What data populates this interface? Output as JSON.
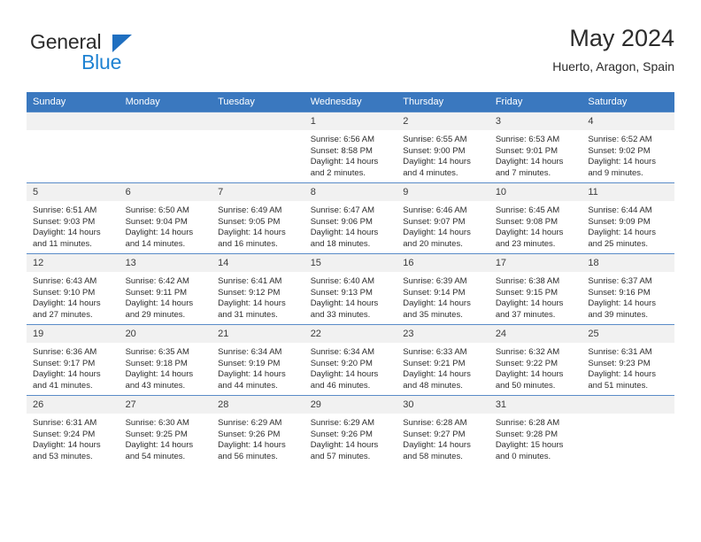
{
  "brand": {
    "name_part1": "General",
    "name_part2": "Blue",
    "triangle_color": "#1f6fc0",
    "blue_color": "#1f82d2"
  },
  "header": {
    "title": "May 2024",
    "subtitle": "Huerto, Aragon, Spain"
  },
  "theme": {
    "header_bg": "#3a78bf",
    "header_text": "#ffffff",
    "daynum_bg": "#f1f1f1",
    "row_divider": "#5a8cc8",
    "body_text": "#2d2d2d"
  },
  "weekdays": [
    "Sunday",
    "Monday",
    "Tuesday",
    "Wednesday",
    "Thursday",
    "Friday",
    "Saturday"
  ],
  "weeks": [
    [
      {
        "day": "",
        "empty": true
      },
      {
        "day": "",
        "empty": true
      },
      {
        "day": "",
        "empty": true
      },
      {
        "day": "1",
        "sunrise": "Sunrise: 6:56 AM",
        "sunset": "Sunset: 8:58 PM",
        "daylight1": "Daylight: 14 hours",
        "daylight2": "and 2 minutes."
      },
      {
        "day": "2",
        "sunrise": "Sunrise: 6:55 AM",
        "sunset": "Sunset: 9:00 PM",
        "daylight1": "Daylight: 14 hours",
        "daylight2": "and 4 minutes."
      },
      {
        "day": "3",
        "sunrise": "Sunrise: 6:53 AM",
        "sunset": "Sunset: 9:01 PM",
        "daylight1": "Daylight: 14 hours",
        "daylight2": "and 7 minutes."
      },
      {
        "day": "4",
        "sunrise": "Sunrise: 6:52 AM",
        "sunset": "Sunset: 9:02 PM",
        "daylight1": "Daylight: 14 hours",
        "daylight2": "and 9 minutes."
      }
    ],
    [
      {
        "day": "5",
        "sunrise": "Sunrise: 6:51 AM",
        "sunset": "Sunset: 9:03 PM",
        "daylight1": "Daylight: 14 hours",
        "daylight2": "and 11 minutes."
      },
      {
        "day": "6",
        "sunrise": "Sunrise: 6:50 AM",
        "sunset": "Sunset: 9:04 PM",
        "daylight1": "Daylight: 14 hours",
        "daylight2": "and 14 minutes."
      },
      {
        "day": "7",
        "sunrise": "Sunrise: 6:49 AM",
        "sunset": "Sunset: 9:05 PM",
        "daylight1": "Daylight: 14 hours",
        "daylight2": "and 16 minutes."
      },
      {
        "day": "8",
        "sunrise": "Sunrise: 6:47 AM",
        "sunset": "Sunset: 9:06 PM",
        "daylight1": "Daylight: 14 hours",
        "daylight2": "and 18 minutes."
      },
      {
        "day": "9",
        "sunrise": "Sunrise: 6:46 AM",
        "sunset": "Sunset: 9:07 PM",
        "daylight1": "Daylight: 14 hours",
        "daylight2": "and 20 minutes."
      },
      {
        "day": "10",
        "sunrise": "Sunrise: 6:45 AM",
        "sunset": "Sunset: 9:08 PM",
        "daylight1": "Daylight: 14 hours",
        "daylight2": "and 23 minutes."
      },
      {
        "day": "11",
        "sunrise": "Sunrise: 6:44 AM",
        "sunset": "Sunset: 9:09 PM",
        "daylight1": "Daylight: 14 hours",
        "daylight2": "and 25 minutes."
      }
    ],
    [
      {
        "day": "12",
        "sunrise": "Sunrise: 6:43 AM",
        "sunset": "Sunset: 9:10 PM",
        "daylight1": "Daylight: 14 hours",
        "daylight2": "and 27 minutes."
      },
      {
        "day": "13",
        "sunrise": "Sunrise: 6:42 AM",
        "sunset": "Sunset: 9:11 PM",
        "daylight1": "Daylight: 14 hours",
        "daylight2": "and 29 minutes."
      },
      {
        "day": "14",
        "sunrise": "Sunrise: 6:41 AM",
        "sunset": "Sunset: 9:12 PM",
        "daylight1": "Daylight: 14 hours",
        "daylight2": "and 31 minutes."
      },
      {
        "day": "15",
        "sunrise": "Sunrise: 6:40 AM",
        "sunset": "Sunset: 9:13 PM",
        "daylight1": "Daylight: 14 hours",
        "daylight2": "and 33 minutes."
      },
      {
        "day": "16",
        "sunrise": "Sunrise: 6:39 AM",
        "sunset": "Sunset: 9:14 PM",
        "daylight1": "Daylight: 14 hours",
        "daylight2": "and 35 minutes."
      },
      {
        "day": "17",
        "sunrise": "Sunrise: 6:38 AM",
        "sunset": "Sunset: 9:15 PM",
        "daylight1": "Daylight: 14 hours",
        "daylight2": "and 37 minutes."
      },
      {
        "day": "18",
        "sunrise": "Sunrise: 6:37 AM",
        "sunset": "Sunset: 9:16 PM",
        "daylight1": "Daylight: 14 hours",
        "daylight2": "and 39 minutes."
      }
    ],
    [
      {
        "day": "19",
        "sunrise": "Sunrise: 6:36 AM",
        "sunset": "Sunset: 9:17 PM",
        "daylight1": "Daylight: 14 hours",
        "daylight2": "and 41 minutes."
      },
      {
        "day": "20",
        "sunrise": "Sunrise: 6:35 AM",
        "sunset": "Sunset: 9:18 PM",
        "daylight1": "Daylight: 14 hours",
        "daylight2": "and 43 minutes."
      },
      {
        "day": "21",
        "sunrise": "Sunrise: 6:34 AM",
        "sunset": "Sunset: 9:19 PM",
        "daylight1": "Daylight: 14 hours",
        "daylight2": "and 44 minutes."
      },
      {
        "day": "22",
        "sunrise": "Sunrise: 6:34 AM",
        "sunset": "Sunset: 9:20 PM",
        "daylight1": "Daylight: 14 hours",
        "daylight2": "and 46 minutes."
      },
      {
        "day": "23",
        "sunrise": "Sunrise: 6:33 AM",
        "sunset": "Sunset: 9:21 PM",
        "daylight1": "Daylight: 14 hours",
        "daylight2": "and 48 minutes."
      },
      {
        "day": "24",
        "sunrise": "Sunrise: 6:32 AM",
        "sunset": "Sunset: 9:22 PM",
        "daylight1": "Daylight: 14 hours",
        "daylight2": "and 50 minutes."
      },
      {
        "day": "25",
        "sunrise": "Sunrise: 6:31 AM",
        "sunset": "Sunset: 9:23 PM",
        "daylight1": "Daylight: 14 hours",
        "daylight2": "and 51 minutes."
      }
    ],
    [
      {
        "day": "26",
        "sunrise": "Sunrise: 6:31 AM",
        "sunset": "Sunset: 9:24 PM",
        "daylight1": "Daylight: 14 hours",
        "daylight2": "and 53 minutes."
      },
      {
        "day": "27",
        "sunrise": "Sunrise: 6:30 AM",
        "sunset": "Sunset: 9:25 PM",
        "daylight1": "Daylight: 14 hours",
        "daylight2": "and 54 minutes."
      },
      {
        "day": "28",
        "sunrise": "Sunrise: 6:29 AM",
        "sunset": "Sunset: 9:26 PM",
        "daylight1": "Daylight: 14 hours",
        "daylight2": "and 56 minutes."
      },
      {
        "day": "29",
        "sunrise": "Sunrise: 6:29 AM",
        "sunset": "Sunset: 9:26 PM",
        "daylight1": "Daylight: 14 hours",
        "daylight2": "and 57 minutes."
      },
      {
        "day": "30",
        "sunrise": "Sunrise: 6:28 AM",
        "sunset": "Sunset: 9:27 PM",
        "daylight1": "Daylight: 14 hours",
        "daylight2": "and 58 minutes."
      },
      {
        "day": "31",
        "sunrise": "Sunrise: 6:28 AM",
        "sunset": "Sunset: 9:28 PM",
        "daylight1": "Daylight: 15 hours",
        "daylight2": "and 0 minutes."
      },
      {
        "day": "",
        "empty": true
      }
    ]
  ]
}
